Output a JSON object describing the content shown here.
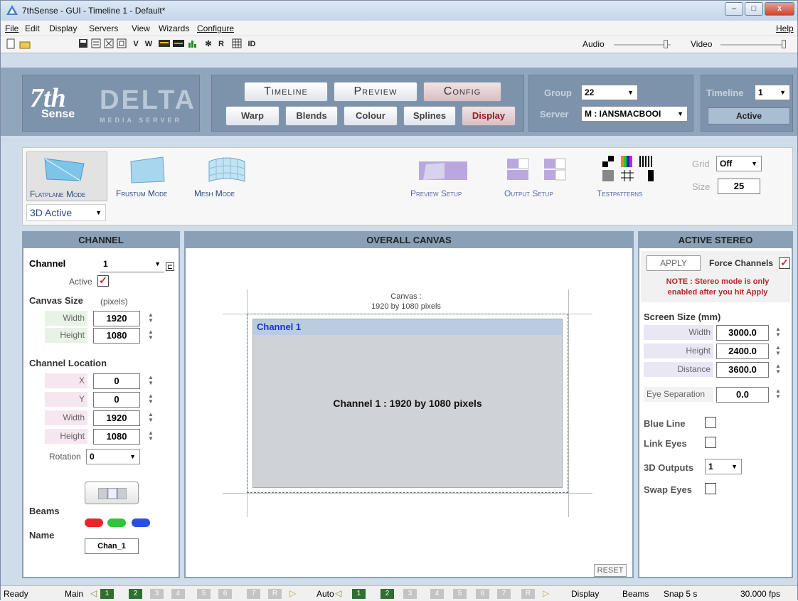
{
  "window": {
    "title": "7thSense - GUI - Timeline 1 - Default*",
    "minimize": "–",
    "maximize": "□",
    "close": "x"
  },
  "menu": {
    "items": [
      "File",
      "Edit",
      "Display",
      "Servers",
      "View",
      "Wizards",
      "Configure"
    ],
    "help": "Help"
  },
  "toolbar": {
    "letters": [
      "V",
      "W",
      "R",
      "ID"
    ],
    "audio_label": "Audio",
    "video_label": "Video"
  },
  "logo": {
    "brand": "7th",
    "brand_sub": "Sense",
    "product": "DELTA",
    "product_sub": "MEDIA SERVER"
  },
  "tabs": {
    "main": [
      "Timeline",
      "Preview",
      "Config"
    ],
    "sub": [
      "Warp",
      "Blends",
      "Colour",
      "Splines",
      "Display"
    ]
  },
  "group_server": {
    "group_label": "Group",
    "group_value": "22",
    "server_label": "Server",
    "server_value": "M : IANSMACBOOI"
  },
  "timeline": {
    "label": "Timeline",
    "value": "1",
    "status": "Active"
  },
  "modes": {
    "flatplane": "Flatplane Mode",
    "frustum": "Frustum Mode",
    "mesh": "Mesh Mode",
    "preview_setup": "Preview Setup",
    "output_setup": "Output Setup",
    "testpatterns": "Testpatterns",
    "grid_label": "Grid",
    "grid_value": "Off",
    "size_label": "Size",
    "size_value": "25",
    "stereo_mode": "3D Active"
  },
  "channel": {
    "title": "CHANNEL",
    "channel_label": "Channel",
    "channel_value": "1",
    "active_label": "Active",
    "canvas_size_label": "Canvas Size",
    "canvas_size_unit": "(pixels)",
    "width_label": "Width",
    "width_value": "1920",
    "height_label": "Height",
    "height_value": "1080",
    "location_label": "Channel Location",
    "x_label": "X",
    "x_value": "0",
    "y_label": "Y",
    "y_value": "0",
    "loc_width_label": "Width",
    "loc_width_value": "1920",
    "loc_height_label": "Height",
    "loc_height_value": "1080",
    "rotation_label": "Rotation",
    "rotation_value": "0",
    "beams_label": "Beams",
    "name_label": "Name",
    "name_value": "Chan_1",
    "beam_colors": [
      "#e8262a",
      "#2ec53c",
      "#2a4fe0"
    ]
  },
  "canvas": {
    "title": "OVERALL CANVAS",
    "canvas_caption": "Canvas :",
    "canvas_caption2": "1920 by 1080 pixels",
    "channel_header": "Channel 1",
    "channel_text": "Channel 1 : 1920 by 1080 pixels",
    "reset": "RESET"
  },
  "stereo": {
    "title": "ACTIVE STEREO",
    "apply": "APPLY",
    "force_label": "Force Channels",
    "note": "NOTE : Stereo mode is only enabled after you hit Apply",
    "screen_size_label": "Screen Size (mm)",
    "width_label": "Width",
    "width_value": "3000.0",
    "height_label": "Height",
    "height_value": "2400.0",
    "distance_label": "Distance",
    "distance_value": "3600.0",
    "eye_sep_label": "Eye Separation",
    "eye_sep_value": "0.0",
    "blue_line": "Blue Line",
    "link_eyes": "Link Eyes",
    "outputs_label": "3D Outputs",
    "outputs_value": "1",
    "swap_eyes": "Swap Eyes"
  },
  "status": {
    "ready": "Ready",
    "main_label": "Main",
    "main_slots": [
      "1",
      "2",
      "3",
      "4",
      "5",
      "6",
      "7",
      "R"
    ],
    "auto_label": "Auto",
    "auto_slots": [
      "1",
      "2",
      "3",
      "4",
      "5",
      "6",
      "7",
      "R"
    ],
    "display": "Display",
    "beams": "Beams",
    "snap": "Snap 5 s",
    "fps": "30.000 fps"
  }
}
